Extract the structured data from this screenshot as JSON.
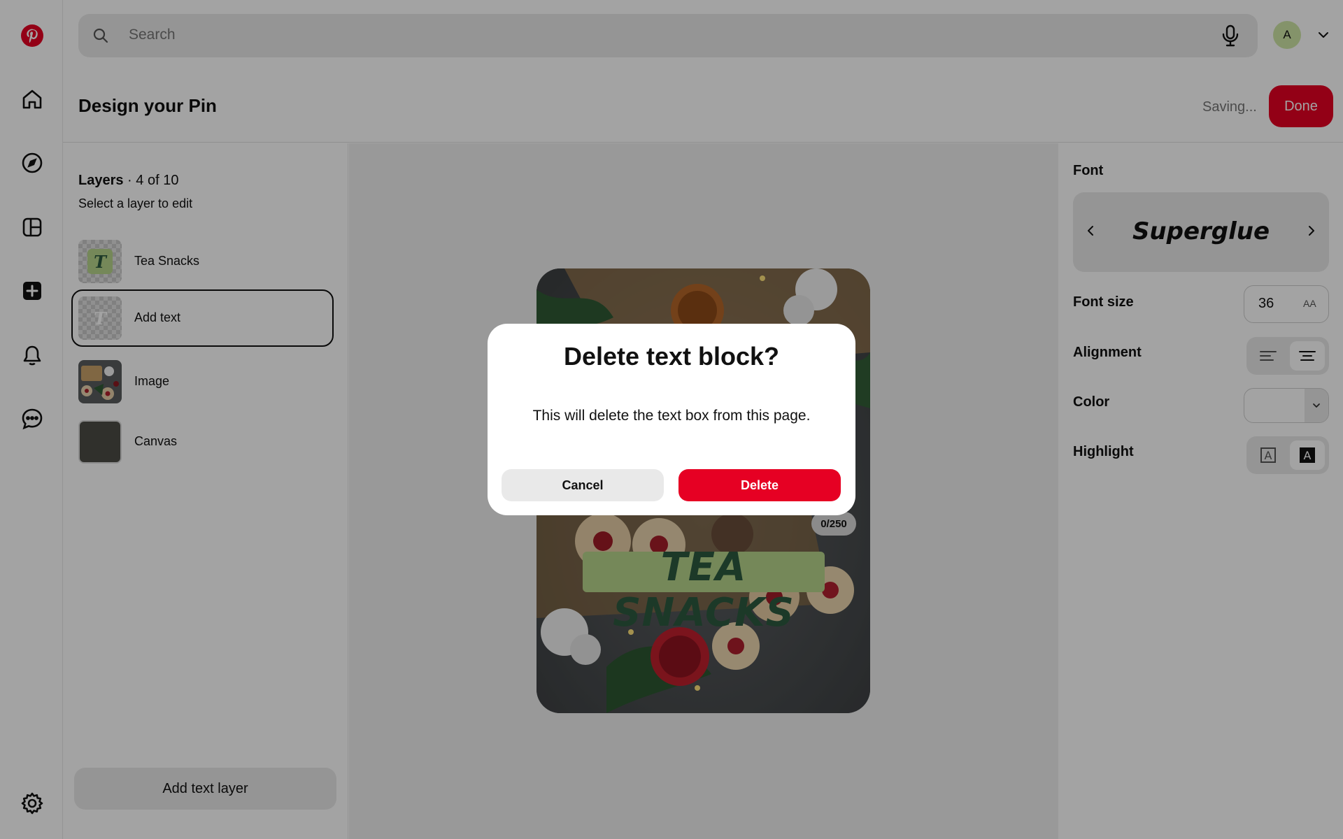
{
  "nav": {
    "icons": [
      "pinterest-logo",
      "home-icon",
      "explore-icon",
      "boards-icon",
      "create-icon",
      "notifications-icon",
      "messages-icon",
      "settings-icon"
    ]
  },
  "search": {
    "placeholder": "Search"
  },
  "account": {
    "initial": "A"
  },
  "header": {
    "title": "Design your Pin",
    "status": "Saving...",
    "done_label": "Done"
  },
  "layers": {
    "heading": "Layers",
    "count": " · 4 of 10",
    "subtitle": "Select a layer to edit",
    "items": [
      {
        "label": "Tea Snacks",
        "glyph": "T"
      },
      {
        "label": "Add text",
        "glyph": "T"
      },
      {
        "label": "Image"
      },
      {
        "label": "Canvas"
      }
    ],
    "add_label": "Add text layer"
  },
  "canvas": {
    "pin_text": "TEA SNACKS",
    "char_counter": "0/250"
  },
  "props": {
    "font_label": "Font",
    "font_name": "Superglue",
    "font_size_label": "Font size",
    "font_size_value": "36",
    "font_size_toggle": "AA",
    "alignment_label": "Alignment",
    "alignment_selected": "center",
    "color_label": "Color",
    "highlight_label": "Highlight",
    "highlight_selected": "filled",
    "highlight_glyph": "A"
  },
  "modal": {
    "title": "Delete text block?",
    "body": "This will delete the text box from this page.",
    "cancel_label": "Cancel",
    "delete_label": "Delete"
  },
  "colors": {
    "brand_red": "#e60023",
    "tea_snacks_text": "#2d5a3f",
    "tea_snacks_highlight": "#b7d58b"
  }
}
